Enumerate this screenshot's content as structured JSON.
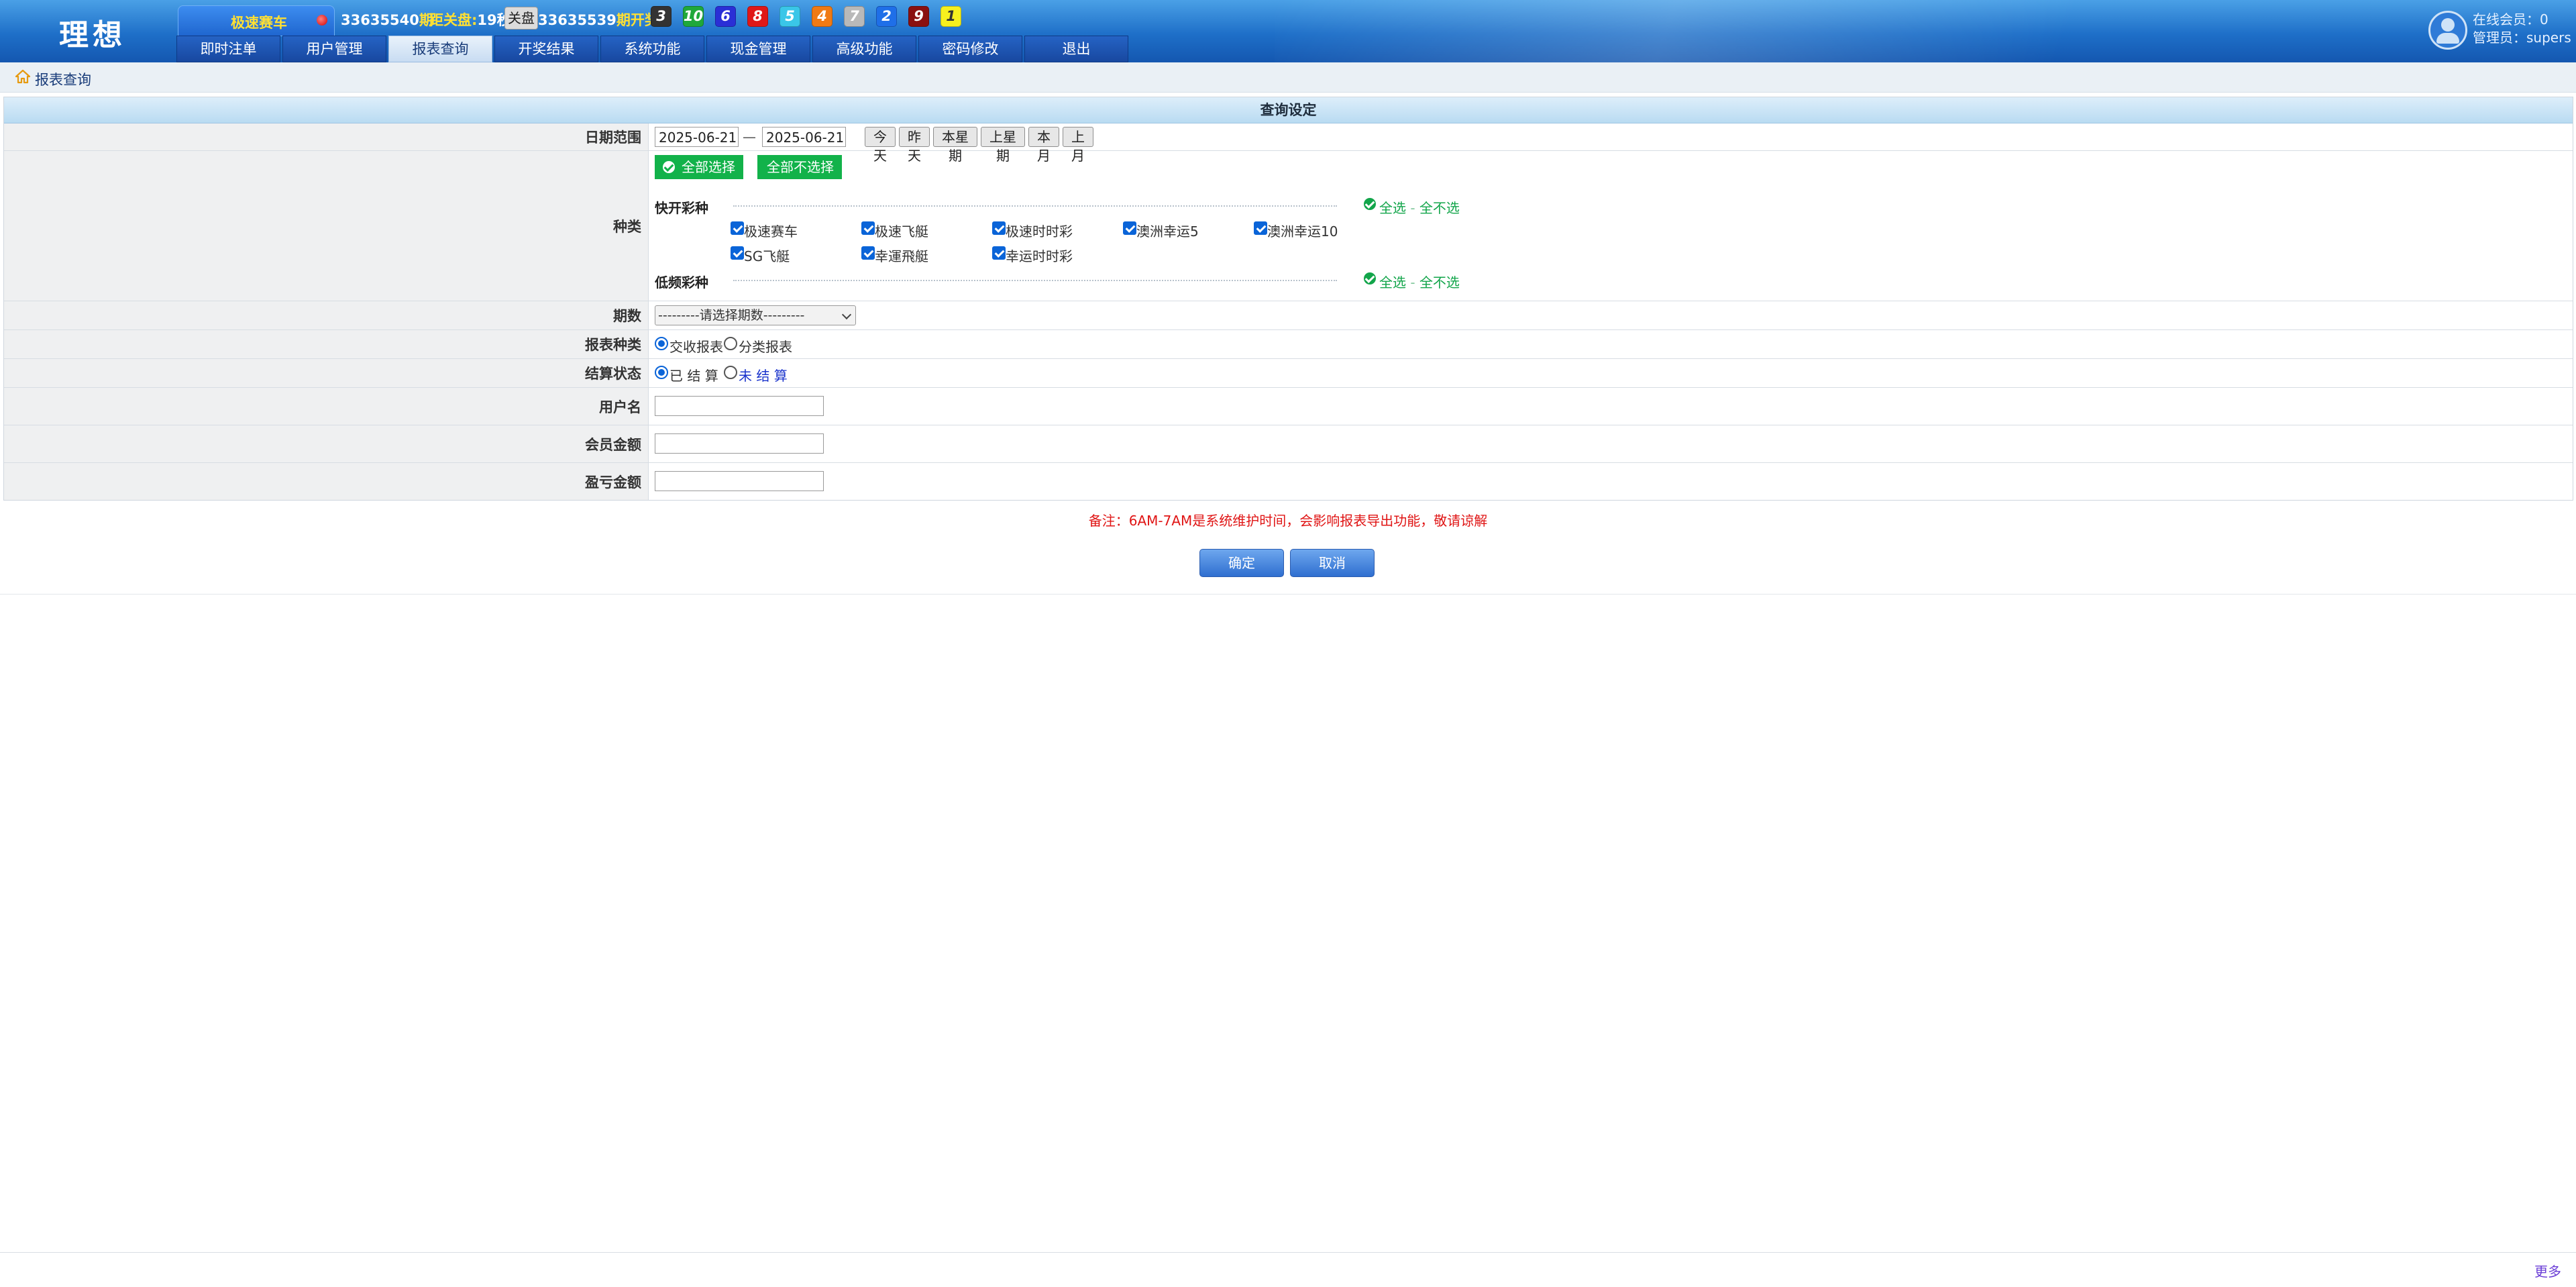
{
  "header": {
    "logo": "理想",
    "game_name": "极速赛车",
    "current_issue": "33635540",
    "issue_suffix": "期",
    "close_label_prefix": "距关盘:",
    "close_countdown": "19秒",
    "close_status": "关盘",
    "last_issue": "33635539",
    "last_issue_suffix": "期开奖:",
    "balls": [
      {
        "n": "3",
        "bg": "#333333",
        "fg": "#ffffff"
      },
      {
        "n": "10",
        "bg": "#1fa83a",
        "fg": "#ffffff"
      },
      {
        "n": "6",
        "bg": "#2a2fd6",
        "fg": "#ffffff"
      },
      {
        "n": "8",
        "bg": "#e01818",
        "fg": "#ffffff"
      },
      {
        "n": "5",
        "bg": "#3ac6e8",
        "fg": "#ffffff"
      },
      {
        "n": "4",
        "bg": "#f07a14",
        "fg": "#ffffff"
      },
      {
        "n": "7",
        "bg": "#b9b9b9",
        "fg": "#ffffff"
      },
      {
        "n": "2",
        "bg": "#1f6fe8",
        "fg": "#ffffff"
      },
      {
        "n": "9",
        "bg": "#8a1010",
        "fg": "#ffffff"
      },
      {
        "n": "1",
        "bg": "#f6f01e",
        "fg": "#333333"
      }
    ],
    "nav": [
      "即时注单",
      "用户管理",
      "报表查询",
      "开奖结果",
      "系统功能",
      "现金管理",
      "高级功能",
      "密码修改",
      "退出"
    ],
    "nav_active_index": 2,
    "online_label": "在线会员：",
    "online_count": "0",
    "admin_label": "管理员：",
    "admin_name": "supers"
  },
  "breadcrumb": {
    "label": "报表查询"
  },
  "form": {
    "title": "查询设定",
    "date_range": {
      "label": "日期范围",
      "start": "2025-06-21",
      "separator": "—",
      "end": "2025-06-21",
      "quick": [
        "今天",
        "昨天",
        "本星期",
        "上星期",
        "本月",
        "上月"
      ]
    },
    "category": {
      "label": "种类",
      "select_all": "全部选择",
      "select_none": "全部不选择",
      "fast_group": "快开彩种",
      "slow_group": "低频彩种",
      "group_all": "全选",
      "group_none": "全不选",
      "fast_items": [
        {
          "label": "极速赛车",
          "checked": true
        },
        {
          "label": "极速飞艇",
          "checked": true
        },
        {
          "label": "极速时时彩",
          "checked": true
        },
        {
          "label": "澳洲幸运5",
          "checked": true
        },
        {
          "label": "澳洲幸运10",
          "checked": true
        },
        {
          "label": "SG飞艇",
          "checked": true
        },
        {
          "label": "幸運飛艇",
          "checked": true
        },
        {
          "label": "幸运时时彩",
          "checked": true
        }
      ]
    },
    "period": {
      "label": "期数",
      "placeholder": "---------请选择期数---------"
    },
    "report_type": {
      "label": "报表种类",
      "options": [
        "交收报表",
        "分类报表"
      ],
      "selected": 0
    },
    "settle_status": {
      "label": "结算状态",
      "options": [
        "已 结 算",
        "未 结 算"
      ],
      "selected": 0
    },
    "username": {
      "label": "用户名",
      "value": ""
    },
    "member_amount": {
      "label": "会员金额",
      "value": ""
    },
    "profit_amount": {
      "label": "盈亏金额",
      "value": ""
    }
  },
  "note": "备注：6AM-7AM是系统维护时间，会影响报表导出功能，敬请谅解",
  "actions": {
    "ok": "确定",
    "cancel": "取消"
  },
  "footer": {
    "more": "更多"
  }
}
